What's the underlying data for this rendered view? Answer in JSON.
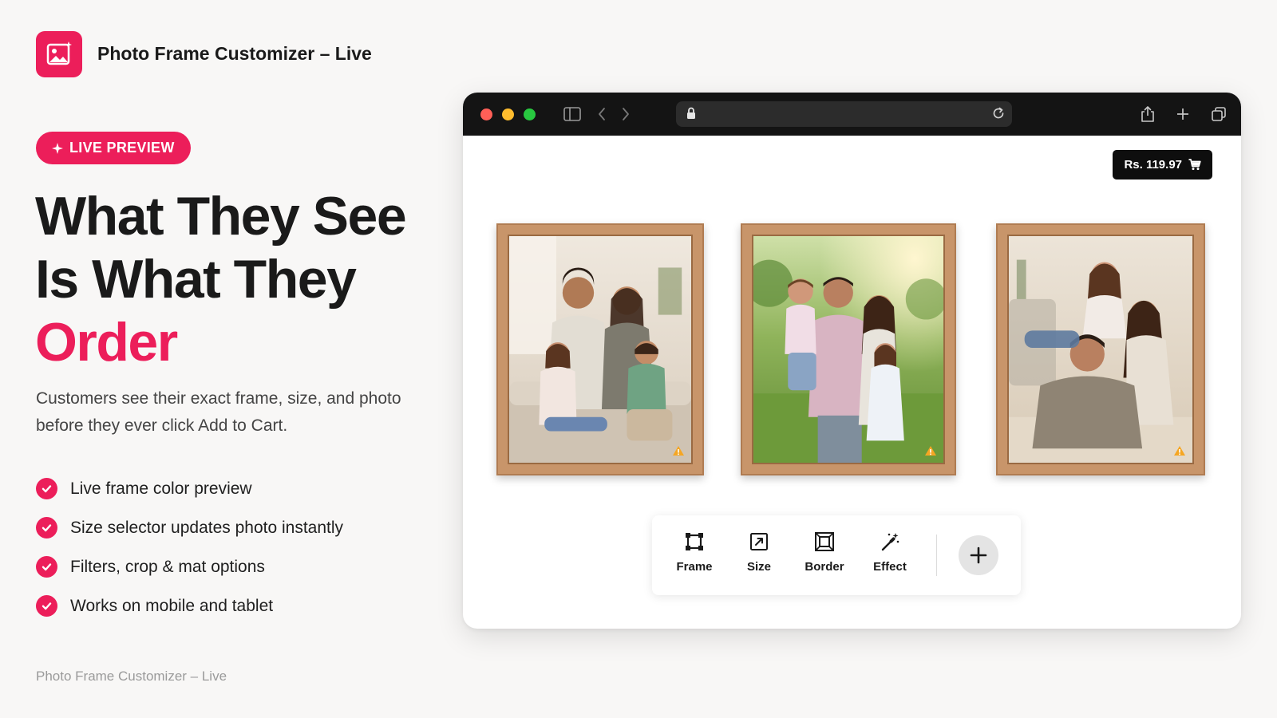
{
  "app": {
    "title": "Photo Frame Customizer – Live",
    "logo_icon": "image-sparkle-icon",
    "brand_color": "#ec1e5a"
  },
  "hero": {
    "badge": "LIVE PREVIEW",
    "headline_line1": "What They See",
    "headline_line2": "Is What They",
    "headline_accent": "Order",
    "subtext": "Customers see their exact frame, size, and photo before they ever click Add to Cart."
  },
  "features": [
    "Live frame color preview",
    "Size selector updates photo instantly",
    "Filters, crop & mat options",
    "Works on mobile and tablet"
  ],
  "footer": {
    "text": "Photo Frame Customizer – Live"
  },
  "browser": {
    "url": "",
    "cart_button": "Rs. 119.97",
    "cart_icon": "cart-icon",
    "frames": [
      {
        "photo": "family-on-sofa",
        "frame_color": "#c8956a"
      },
      {
        "photo": "family-outdoors",
        "frame_color": "#c8956a"
      },
      {
        "photo": "family-on-floor",
        "frame_color": "#c8956a"
      }
    ],
    "toolbar": {
      "tools": [
        {
          "label": "Frame",
          "icon": "frame-crop-icon"
        },
        {
          "label": "Size",
          "icon": "resize-icon"
        },
        {
          "label": "Border",
          "icon": "border-icon"
        },
        {
          "label": "Effect",
          "icon": "magic-wand-icon"
        }
      ],
      "add_icon": "plus-icon"
    }
  }
}
